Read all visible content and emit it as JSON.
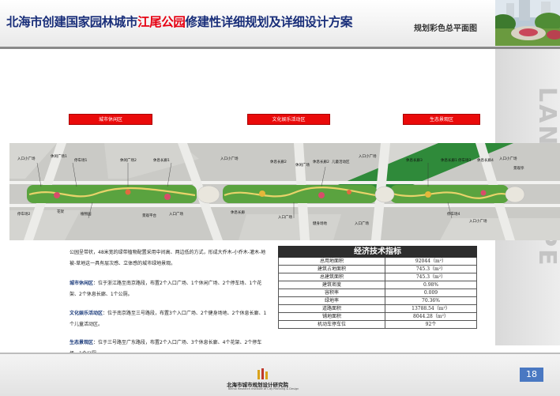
{
  "header": {
    "title_pre": "北海市创建国家园林城市",
    "title_highlight": "江尾公园",
    "title_post": "修建性详细规划及详细设计方案",
    "subtitle": "规划彩色总平面图"
  },
  "side_watermark": "LANDSCAPE",
  "zones": [
    {
      "label": "城市休闲区"
    },
    {
      "label": "文化娱乐活动区"
    },
    {
      "label": "生态景观区"
    }
  ],
  "plan_labels": [
    "入口小广场",
    "休闲广场1",
    "停车场1",
    "休闲广场2",
    "休息长廊1",
    "入口小广场",
    "休息长廊2",
    "休闲广场",
    "休息长廊2",
    "儿童活动区",
    "入口小广场",
    "休息长廊3",
    "休息长廊1",
    "停车场3",
    "休息长廊4",
    "入口小广场",
    "停车场2",
    "花架",
    "植物园",
    "景观平台",
    "入口广场",
    "休息长廊",
    "入口广场",
    "健身场地",
    "入口广场",
    "入口小广场",
    "停车场4",
    "景观亭"
  ],
  "description": {
    "intro": "公园呈带状，48米宽的绿带植物配置采用中间高、两边低的方式，形成大乔木-小乔木-灌木-地被-草地这一具有层次感、立体感的城市绿地景观。",
    "zone1_title": "城市休闲区",
    "zone1_text": "：位于浙江路至南京路段，布置2个入口广场、1个休闲广场、2个停车场、1个花架、2个休息长廊、1个公厕。",
    "zone2_title": "文化娱乐活动区",
    "zone2_text": "：位于南京路至三号路段，布置3个入口广场、2个健身场地、2个休息长廊、1个儿童活动区。",
    "zone3_title": "生态景观区",
    "zone3_text": "：位于三号路至广东路段，布置2个入口广场、3个休息长廊、4个花架、2个停车场、1个公厕。"
  },
  "econ_table": {
    "title": "经济技术指标",
    "rows": [
      {
        "name": "总用地面积",
        "value": "92044（m²）"
      },
      {
        "name": "建筑占地面积",
        "value": "745.3（m²）"
      },
      {
        "name": "总建筑面积",
        "value": "745.3（m²）"
      },
      {
        "name": "建筑密度",
        "value": "0.98%"
      },
      {
        "name": "容积率",
        "value": "0.009"
      },
      {
        "name": "绿地率",
        "value": "70.36%"
      },
      {
        "name": "道路面积",
        "value": "13788.54（m²）"
      },
      {
        "name": "铺地面积",
        "value": "8044.28（m²）"
      },
      {
        "name": "机动车停车位",
        "value": "92个"
      }
    ]
  },
  "footer": {
    "logo_text": "北海市城市规划设计研究院",
    "logo_sub": "Beihai Research Institute of City Planning & Design",
    "page_number": "18"
  }
}
